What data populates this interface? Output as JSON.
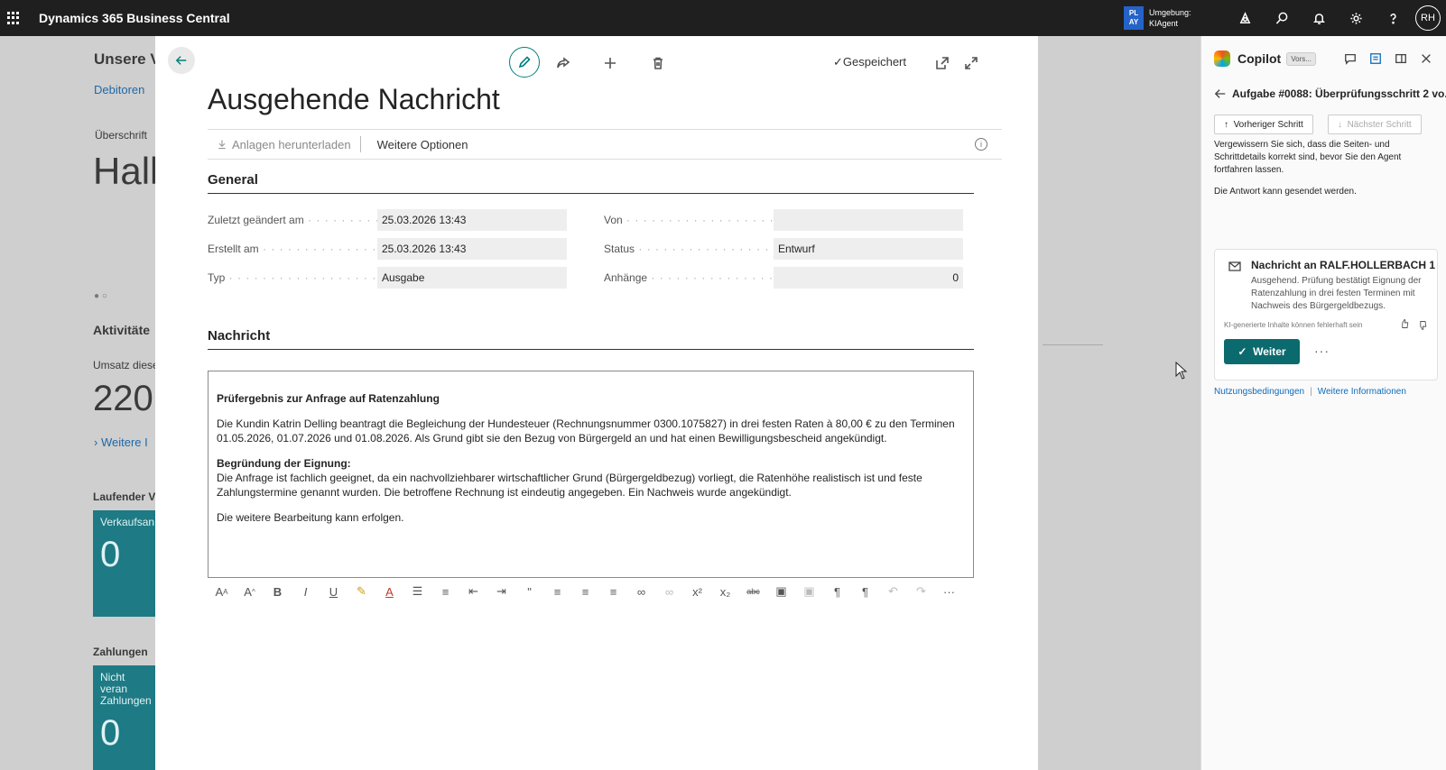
{
  "topbar": {
    "app_title": "Dynamics 365 Business Central",
    "env_badge": "PL AY",
    "env_label": "Umgebung:",
    "env_value": "KIAgent",
    "avatar": "RH"
  },
  "background": {
    "heading": "Unsere V",
    "link": "Debitoren",
    "subheading_label": "Überschrift",
    "greeting": "Hall",
    "activities": "Aktivitäte",
    "revenue_label": "Umsatz diese",
    "revenue_value": "220",
    "more_link": "Weitere I",
    "current_label": "Laufender V",
    "tile1_label": "Verkaufsan",
    "tile1_value": "0",
    "payments_label": "Zahlungen",
    "tile2_label": "Nicht veran Zahlungen",
    "tile2_value": "0"
  },
  "modal": {
    "saved_label": "Gespeichert",
    "title": "Ausgehende Nachricht",
    "actions": {
      "download": "Anlagen herunterladen",
      "more": "Weitere Optionen"
    },
    "general": {
      "title": "General",
      "fields": {
        "last_modified_label": "Zuletzt geändert am",
        "last_modified_value": "25.03.2026 13:43",
        "created_label": "Erstellt am",
        "created_value": "25.03.2026 13:43",
        "type_label": "Typ",
        "type_value": "Ausgabe",
        "from_label": "Von",
        "from_value": "",
        "status_label": "Status",
        "status_value": "Entwurf",
        "attachments_label": "Anhänge",
        "attachments_value": "0"
      }
    },
    "message": {
      "title": "Nachricht",
      "heading": "Prüfergebnis zur Anfrage auf Ratenzahlung",
      "para1": "Die Kundin Katrin Delling beantragt die Begleichung der Hundesteuer (Rechnungsnummer 0300.1075827) in drei festen Raten à 80,00 € zu den Terminen 01.05.2026, 01.07.2026 und 01.08.2026. Als Grund gibt sie den Bezug von Bürgergeld an und hat einen Bewilligungsbescheid angekündigt.",
      "reason_heading": "Begründung der Eignung:",
      "para2": "Die Anfrage ist fachlich geeignet, da ein nachvollziehbarer wirtschaftlicher Grund (Bürgergeldbezug) vorliegt, die Ratenhöhe realistisch ist und feste Zahlungstermine genannt wurden. Die betroffene Rechnung ist eindeutig angegeben. Ein Nachweis wurde angekündigt.",
      "para3": "Die weitere Bearbeitung kann erfolgen."
    }
  },
  "copilot": {
    "title": "Copilot",
    "badge": "Vors...",
    "task_title": "Aufgabe #0088: Überprüfungsschritt 2 vo...",
    "prev_step": "Vorheriger Schritt",
    "next_step": "Nächster Schritt",
    "instruction": "Vergewissern Sie sich, dass die Seiten- und Schrittdetails korrekt sind, bevor Sie den Agent fortfahren lassen.",
    "status": "Die Antwort kann gesendet werden.",
    "card": {
      "title": "Nachricht an RALF.HOLLERBACH 1",
      "desc": "Ausgehend. Prüfung bestätigt Eignung der Ratenzahlung in drei festen Terminen mit Nachweis des Bürgergeldbezugs.",
      "disclaimer": "KI-generierte Inhalte können fehlerhaft sein",
      "continue": "Weiter"
    },
    "terms_link": "Nutzungsbedingungen",
    "info_link": "Weitere Informationen"
  }
}
